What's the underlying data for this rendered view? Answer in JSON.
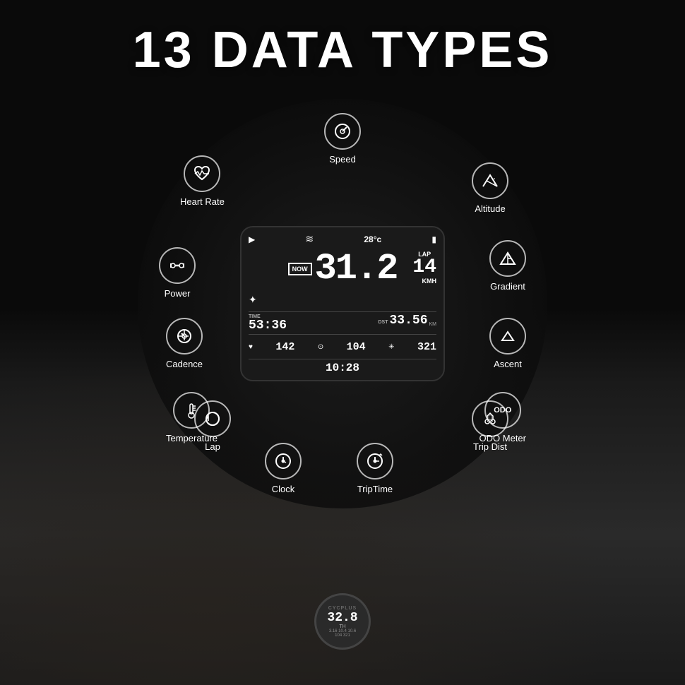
{
  "page": {
    "title": "13 DATA TYPES",
    "background_color": "#0a0a0a"
  },
  "device_screen": {
    "top_row": {
      "play": "▶",
      "wave": "≈",
      "temperature": "28°c",
      "battery": "🔋"
    },
    "main": {
      "now_badge": "NOW",
      "speed": "31.2",
      "lap_label": "LAP",
      "lap_number": "14",
      "kmh": "KMH"
    },
    "bluetooth": "✦",
    "time_row": {
      "time_label": "TIME",
      "time_value": "53:36",
      "dst_label": "DST",
      "dst_value": "33.56",
      "km": "KM"
    },
    "metrics_row": {
      "heart_icon": "♥",
      "heart_value": "142",
      "cadence_icon": "⊙",
      "cadence_value": "104",
      "power_icon": "*",
      "power_value": "321"
    },
    "clock": "10:28"
  },
  "data_types": [
    {
      "id": "speed",
      "label": "Speed",
      "icon": "speedometer"
    },
    {
      "id": "heart-rate",
      "label": "Heart Rate",
      "icon": "heart"
    },
    {
      "id": "altitude",
      "label": "Altitude",
      "icon": "altitude"
    },
    {
      "id": "power",
      "label": "Power",
      "icon": "dumbbell"
    },
    {
      "id": "gradient",
      "label": "Gradient",
      "icon": "gradient"
    },
    {
      "id": "cadence",
      "label": "Cadence",
      "icon": "cadence"
    },
    {
      "id": "ascent",
      "label": "Ascent",
      "icon": "ascent"
    },
    {
      "id": "temperature",
      "label": "Temperature",
      "icon": "thermometer"
    },
    {
      "id": "odo-meter",
      "label": "ODO Meter",
      "icon": "odo"
    },
    {
      "id": "lap",
      "label": "Lap",
      "icon": "lap"
    },
    {
      "id": "trip-dist",
      "label": "Trip Dist",
      "icon": "trip"
    },
    {
      "id": "clock",
      "label": "Clock",
      "icon": "clock"
    },
    {
      "id": "trip-time",
      "label": "TripTime",
      "icon": "triptime"
    }
  ],
  "small_device": {
    "brand": "CYCPLUS",
    "speed": "32.8",
    "unit": "TH",
    "data_line1": "3.16  10.4  10.6",
    "data_line2": "104  321"
  }
}
